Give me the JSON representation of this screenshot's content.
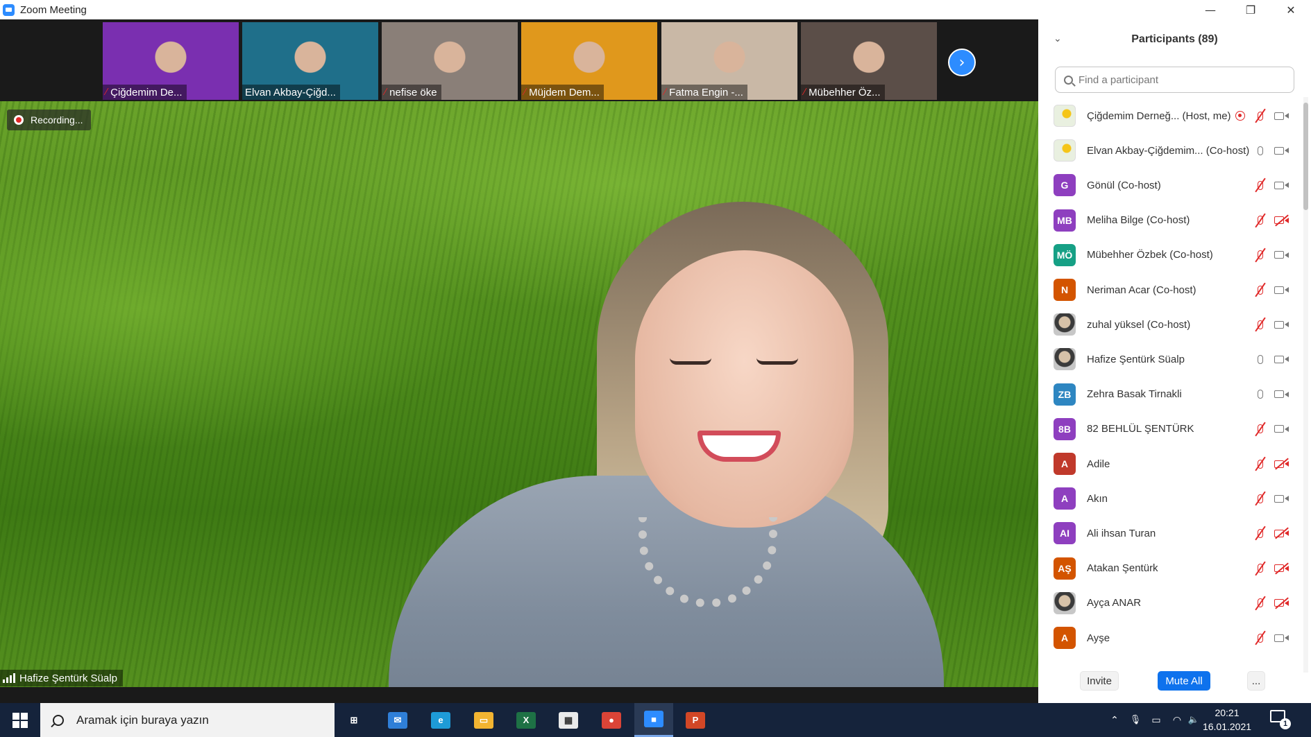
{
  "window": {
    "title": "Zoom Meeting",
    "minimize": "—",
    "restore": "❐",
    "close": "✕"
  },
  "thumbnails": [
    {
      "name": "Çiğdemim De...",
      "muted": true,
      "bg": "#7a2fb0"
    },
    {
      "name": "Elvan Akbay-Çiğd...",
      "muted": false,
      "bg": "#1f6f8a"
    },
    {
      "name": "nefise öke",
      "muted": true,
      "bg": "#8a7f78"
    },
    {
      "name": "Müjdem Dem...",
      "muted": true,
      "bg": "#e0981c"
    },
    {
      "name": "Fatma Engin -...",
      "muted": true,
      "bg": "#c9b8a6"
    },
    {
      "name": "Mübehher Öz...",
      "muted": true,
      "bg": "#5b4e48"
    }
  ],
  "next_page_icon": "›",
  "recording": {
    "label": "Recording..."
  },
  "active_speaker": {
    "name": "Hafize Şentürk Süalp"
  },
  "participants": {
    "title": "Participants (89)",
    "collapse_icon": "⌄",
    "search_placeholder": "Find a participant",
    "list": [
      {
        "name": "Çiğdemim Derneğ... (Host, me)",
        "avatar": "",
        "avatar_type": "logo",
        "color": "",
        "mic_muted": true,
        "cam_off": false,
        "recording": true
      },
      {
        "name": "Elvan Akbay-Çiğdemim... (Co-host)",
        "avatar": "",
        "avatar_type": "logo",
        "color": "",
        "mic_muted": false,
        "cam_off": false,
        "recording": false
      },
      {
        "name": "Gönül (Co-host)",
        "avatar": "G",
        "avatar_type": "initials",
        "color": "#8e3fbf",
        "mic_muted": true,
        "cam_off": false,
        "recording": false
      },
      {
        "name": "Meliha Bilge (Co-host)",
        "avatar": "MB",
        "avatar_type": "initials",
        "color": "#8e3fbf",
        "mic_muted": true,
        "cam_off": true,
        "recording": false
      },
      {
        "name": "Mübehher Özbek (Co-host)",
        "avatar": "MÖ",
        "avatar_type": "initials",
        "color": "#16a085",
        "mic_muted": true,
        "cam_off": false,
        "recording": false
      },
      {
        "name": "Neriman Acar (Co-host)",
        "avatar": "N",
        "avatar_type": "initials",
        "color": "#d35400",
        "mic_muted": true,
        "cam_off": false,
        "recording": false
      },
      {
        "name": "zuhal yüksel (Co-host)",
        "avatar": "",
        "avatar_type": "photo",
        "color": "",
        "mic_muted": true,
        "cam_off": false,
        "recording": false
      },
      {
        "name": "Hafize Şentürk Süalp",
        "avatar": "",
        "avatar_type": "photo",
        "color": "",
        "mic_muted": false,
        "cam_off": false,
        "recording": false
      },
      {
        "name": "Zehra Basak Tirnakli",
        "avatar": "ZB",
        "avatar_type": "initials",
        "color": "#2e86c1",
        "mic_muted": false,
        "cam_off": false,
        "recording": false
      },
      {
        "name": "82 BEHLÜL ŞENTÜRK",
        "avatar": "8B",
        "avatar_type": "initials",
        "color": "#8e3fbf",
        "mic_muted": true,
        "cam_off": false,
        "recording": false
      },
      {
        "name": "Adile",
        "avatar": "A",
        "avatar_type": "initials",
        "color": "#c0392b",
        "mic_muted": true,
        "cam_off": true,
        "recording": false
      },
      {
        "name": "Akın",
        "avatar": "A",
        "avatar_type": "initials",
        "color": "#8e3fbf",
        "mic_muted": true,
        "cam_off": false,
        "recording": false
      },
      {
        "name": "Ali ihsan Turan",
        "avatar": "AI",
        "avatar_type": "initials",
        "color": "#8e3fbf",
        "mic_muted": true,
        "cam_off": true,
        "recording": false
      },
      {
        "name": "Atakan Şentürk",
        "avatar": "AŞ",
        "avatar_type": "initials",
        "color": "#d35400",
        "mic_muted": true,
        "cam_off": true,
        "recording": false
      },
      {
        "name": "Ayça ANAR",
        "avatar": "",
        "avatar_type": "photo",
        "color": "",
        "mic_muted": true,
        "cam_off": true,
        "recording": false
      },
      {
        "name": "Ayşe",
        "avatar": "A",
        "avatar_type": "initials",
        "color": "#d35400",
        "mic_muted": true,
        "cam_off": false,
        "recording": false
      }
    ],
    "invite_label": "Invite",
    "mute_all_label": "Mute All",
    "more_label": "..."
  },
  "taskbar": {
    "search_placeholder": "Aramak için buraya yazın",
    "apps": [
      {
        "name": "task-view",
        "glyph": "⊞",
        "color": "transparent",
        "active": false
      },
      {
        "name": "mail",
        "glyph": "✉",
        "color": "#2f7fd8",
        "active": false
      },
      {
        "name": "edge",
        "glyph": "e",
        "color": "#1e9bd7",
        "active": false
      },
      {
        "name": "file-explorer",
        "glyph": "▭",
        "color": "#f2b431",
        "active": false
      },
      {
        "name": "excel",
        "glyph": "X",
        "color": "#1e7145",
        "active": false
      },
      {
        "name": "store",
        "glyph": "▦",
        "color": "#eaeaea",
        "active": false
      },
      {
        "name": "chrome",
        "glyph": "●",
        "color": "#db4437",
        "active": false
      },
      {
        "name": "zoom",
        "glyph": "■",
        "color": "#2d8cff",
        "active": true
      },
      {
        "name": "powerpoint",
        "glyph": "P",
        "color": "#d24726",
        "active": false
      }
    ],
    "tray": {
      "chevron": "⌃",
      "mic": "🎙",
      "battery": "▭",
      "wifi": "◠",
      "volume": "🔈"
    },
    "time": "20:21",
    "date": "16.01.2021",
    "notifications": "1"
  }
}
